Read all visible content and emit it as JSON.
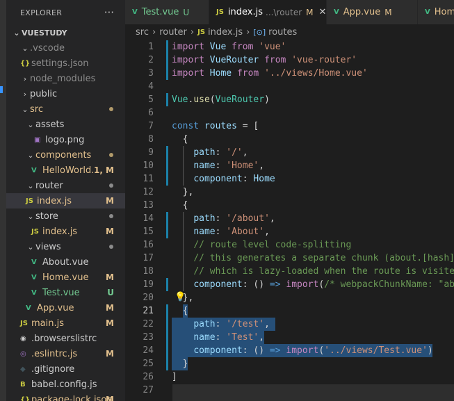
{
  "sidebar": {
    "title": "EXPLORER",
    "more": "···",
    "items": [
      {
        "label": "VUESTUDY",
        "chev": "⌄",
        "kind": "root"
      },
      {
        "label": ".vscode",
        "chev": "⌄",
        "kind": "folder",
        "color": "dim"
      },
      {
        "label": "settings.json",
        "icon": "{}",
        "kind": "json",
        "color": "dim"
      },
      {
        "label": "node_modules",
        "chev": "›",
        "kind": "folder",
        "color": "dim"
      },
      {
        "label": "public",
        "chev": "›",
        "kind": "folder",
        "color": "plain"
      },
      {
        "label": "src",
        "chev": "⌄",
        "kind": "folder",
        "color": "mod",
        "dot": true
      },
      {
        "label": "assets",
        "chev": "⌄",
        "kind": "folder",
        "color": "plain"
      },
      {
        "label": "logo.png",
        "icon": "▣",
        "kind": "image",
        "color": "plain"
      },
      {
        "label": "components",
        "chev": "⌄",
        "kind": "folder",
        "color": "mod",
        "dot": true
      },
      {
        "label": "HelloWorld....",
        "icon": "V",
        "kind": "vue",
        "color": "mod",
        "badge": "1, M"
      },
      {
        "label": "router",
        "chev": "⌄",
        "kind": "folder",
        "color": "plain",
        "dot": true
      },
      {
        "label": "index.js",
        "icon": "JS",
        "kind": "js",
        "color": "mod",
        "badge": "M",
        "selected": true
      },
      {
        "label": "store",
        "chev": "⌄",
        "kind": "folder",
        "color": "plain",
        "dot": true
      },
      {
        "label": "index.js",
        "icon": "JS",
        "kind": "js",
        "color": "mod",
        "badge": "M"
      },
      {
        "label": "views",
        "chev": "⌄",
        "kind": "folder",
        "color": "plain",
        "dot": true
      },
      {
        "label": "About.vue",
        "icon": "V",
        "kind": "vue",
        "color": "plain"
      },
      {
        "label": "Home.vue",
        "icon": "V",
        "kind": "vue",
        "color": "mod",
        "badge": "M"
      },
      {
        "label": "Test.vue",
        "icon": "V",
        "kind": "vue",
        "color": "untr",
        "badge": "U"
      },
      {
        "label": "App.vue",
        "icon": "V",
        "kind": "vue",
        "color": "mod",
        "badge": "M"
      },
      {
        "label": "main.js",
        "icon": "JS",
        "kind": "js",
        "color": "mod",
        "badge": "M"
      },
      {
        "label": ".browserslistrc",
        "icon": "◉",
        "kind": "other",
        "color": "plain"
      },
      {
        "label": ".eslintrc.js",
        "icon": "◎",
        "kind": "eslint",
        "color": "mod",
        "badge": "M"
      },
      {
        "label": ".gitignore",
        "icon": "◆",
        "kind": "git",
        "color": "plain"
      },
      {
        "label": "babel.config.js",
        "icon": "B",
        "kind": "babel",
        "color": "plain"
      },
      {
        "label": "package-lock.json",
        "icon": "{}",
        "kind": "json",
        "color": "mod",
        "badge": "M"
      }
    ]
  },
  "tabs": [
    {
      "icon": "V",
      "label": "Test.vue",
      "badge": "U",
      "badge_color": "#73c991",
      "label_color": "#73c991"
    },
    {
      "icon": "JS",
      "label": "index.js",
      "sub": "...\\router",
      "badge": "M",
      "badge_color": "#e2c08d",
      "active": true,
      "close": "✕"
    },
    {
      "icon": "V",
      "label": "App.vue",
      "badge": "M",
      "badge_color": "#e2c08d",
      "label_color": "#e2c08d"
    },
    {
      "icon": "V",
      "label": "Hom",
      "label_color": "#e2c08d"
    }
  ],
  "breadcrumb": {
    "src": "src",
    "router": "router",
    "file": "index.js",
    "symbol": "routes",
    "file_icon": "JS",
    "symbol_icon": "[⊙]"
  },
  "editor": {
    "line_numbers": [
      "1",
      "2",
      "3",
      "4",
      "5",
      "6",
      "7",
      "8",
      "9",
      "10",
      "11",
      "12",
      "13",
      "14",
      "15",
      "16",
      "17",
      "18",
      "19",
      "20",
      "21",
      "22",
      "23",
      "24",
      "25",
      "26",
      "27"
    ],
    "current_line": "21",
    "modified_lines": [
      "1",
      "2",
      "3",
      "5",
      "9",
      "10",
      "11",
      "14",
      "15",
      "19",
      "21",
      "22",
      "23",
      "24",
      "25"
    ],
    "lines": [
      [
        [
          "kw",
          "import"
        ],
        [
          "pn",
          " "
        ],
        [
          "vr",
          "Vue"
        ],
        [
          "pn",
          " "
        ],
        [
          "kw",
          "from"
        ],
        [
          "pn",
          " "
        ],
        [
          "st",
          "'vue'"
        ]
      ],
      [
        [
          "kw",
          "import"
        ],
        [
          "pn",
          " "
        ],
        [
          "vr",
          "VueRouter"
        ],
        [
          "pn",
          " "
        ],
        [
          "kw",
          "from"
        ],
        [
          "pn",
          " "
        ],
        [
          "st",
          "'vue-router'"
        ]
      ],
      [
        [
          "kw",
          "import"
        ],
        [
          "pn",
          " "
        ],
        [
          "vr",
          "Home"
        ],
        [
          "pn",
          " "
        ],
        [
          "kw",
          "from"
        ],
        [
          "pn",
          " "
        ],
        [
          "st",
          "'../views/Home.vue'"
        ]
      ],
      [],
      [
        [
          "cl",
          "Vue"
        ],
        [
          "pn",
          "."
        ],
        [
          "fn",
          "use"
        ],
        [
          "pn",
          "("
        ],
        [
          "cl",
          "VueRouter"
        ],
        [
          "pn",
          ")"
        ]
      ],
      [],
      [
        [
          "ck",
          "const"
        ],
        [
          "pn",
          " "
        ],
        [
          "vr",
          "routes"
        ],
        [
          "pn",
          " = ["
        ]
      ],
      [
        [
          "pn",
          "  {"
        ]
      ],
      [
        [
          "pn",
          "    "
        ],
        [
          "vr",
          "path"
        ],
        [
          "pn",
          ": "
        ],
        [
          "st",
          "'/'"
        ],
        [
          "pn",
          ","
        ]
      ],
      [
        [
          "pn",
          "    "
        ],
        [
          "vr",
          "name"
        ],
        [
          "pn",
          ": "
        ],
        [
          "st",
          "'Home'"
        ],
        [
          "pn",
          ","
        ]
      ],
      [
        [
          "pn",
          "    "
        ],
        [
          "vr",
          "component"
        ],
        [
          "pn",
          ": "
        ],
        [
          "vr",
          "Home"
        ]
      ],
      [
        [
          "pn",
          "  },"
        ]
      ],
      [
        [
          "pn",
          "  {"
        ]
      ],
      [
        [
          "pn",
          "    "
        ],
        [
          "vr",
          "path"
        ],
        [
          "pn",
          ": "
        ],
        [
          "st",
          "'/about'"
        ],
        [
          "pn",
          ","
        ]
      ],
      [
        [
          "pn",
          "    "
        ],
        [
          "vr",
          "name"
        ],
        [
          "pn",
          ": "
        ],
        [
          "st",
          "'About'"
        ],
        [
          "pn",
          ","
        ]
      ],
      [
        [
          "pn",
          "    "
        ],
        [
          "cm",
          "// route level code-splitting"
        ]
      ],
      [
        [
          "pn",
          "    "
        ],
        [
          "cm",
          "// this generates a separate chunk (about.[hash].js) for this route"
        ]
      ],
      [
        [
          "pn",
          "    "
        ],
        [
          "cm",
          "// which is lazy-loaded when the route is visited."
        ]
      ],
      [
        [
          "pn",
          "    "
        ],
        [
          "vr",
          "component"
        ],
        [
          "pn",
          ": () "
        ],
        [
          "ck",
          "=>"
        ],
        [
          "pn",
          " "
        ],
        [
          "kw",
          "import"
        ],
        [
          "pn",
          "("
        ],
        [
          "cm",
          "/* webpackChunkName: \"about\" */"
        ]
      ],
      [
        [
          "pn",
          "  },"
        ]
      ],
      [
        [
          "pn",
          "  {"
        ]
      ],
      [
        [
          "pn",
          "    "
        ],
        [
          "vr",
          "path"
        ],
        [
          "pn",
          ": "
        ],
        [
          "st",
          "'/test'"
        ],
        [
          "pn",
          ","
        ]
      ],
      [
        [
          "pn",
          "    "
        ],
        [
          "vr",
          "name"
        ],
        [
          "pn",
          ": "
        ],
        [
          "st",
          "'Test'"
        ],
        [
          "pn",
          ","
        ]
      ],
      [
        [
          "pn",
          "    "
        ],
        [
          "vr",
          "component"
        ],
        [
          "pn",
          ": () "
        ],
        [
          "ck",
          "=>"
        ],
        [
          "pn",
          " "
        ],
        [
          "kw",
          "import"
        ],
        [
          "pn",
          "("
        ],
        [
          "st",
          "'../views/Test.vue'"
        ],
        [
          "pn",
          ")"
        ]
      ],
      [
        [
          "pn",
          "  }"
        ]
      ],
      [
        [
          "pn",
          "]"
        ]
      ],
      []
    ],
    "bulb": "💡"
  }
}
